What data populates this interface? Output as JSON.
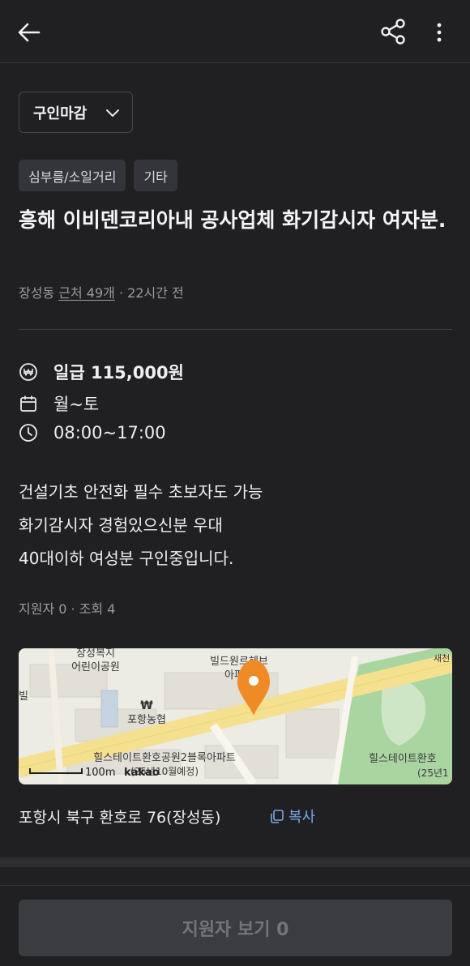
{
  "header": {
    "back_icon": "arrow-left-icon",
    "share_icon": "share-icon",
    "more_icon": "more-vertical-icon"
  },
  "status_select": {
    "label": "구인마감",
    "icon": "chevron-down-icon"
  },
  "tags": [
    "심부름/소일거리",
    "기타"
  ],
  "post": {
    "title": "흥해 이비덴코리아내 공사업체 화기감시자 여자분.",
    "location": "장성동",
    "nearby": "근처 49개",
    "time_ago": "· 22시간 전"
  },
  "details": {
    "wage": "일급 115,000원",
    "days": "월~토",
    "hours": "08:00~17:00"
  },
  "description": [
    "건설기초 안전화 필수 초보자도 가능",
    "화기감시자 경험있으신분 우대",
    "40대이하 여성분 구인중입니다."
  ],
  "stats": "지원자 0 · 조회 4",
  "map": {
    "labels": {
      "school": "장성복지\n어린이공원",
      "bldg": "빌드원르헤브\n아파트",
      "bank": "포항농협",
      "apt1": "힐스테이트환호공원2블록아파트\n(25년10월예정)",
      "apt2": "힐스테이트환호\n(25년1",
      "left": "빌",
      "road": "새천",
      "scale": "100m",
      "brand": "kakao"
    },
    "colors": {
      "road": "#f5e08f",
      "park": "#a9d6a0",
      "block": "#e4e2da",
      "pin": "#f08a24"
    }
  },
  "address": "포항시 북구 환호로 76(장성동)",
  "copy_label": "복사",
  "cta_label": "지원자 보기 0"
}
